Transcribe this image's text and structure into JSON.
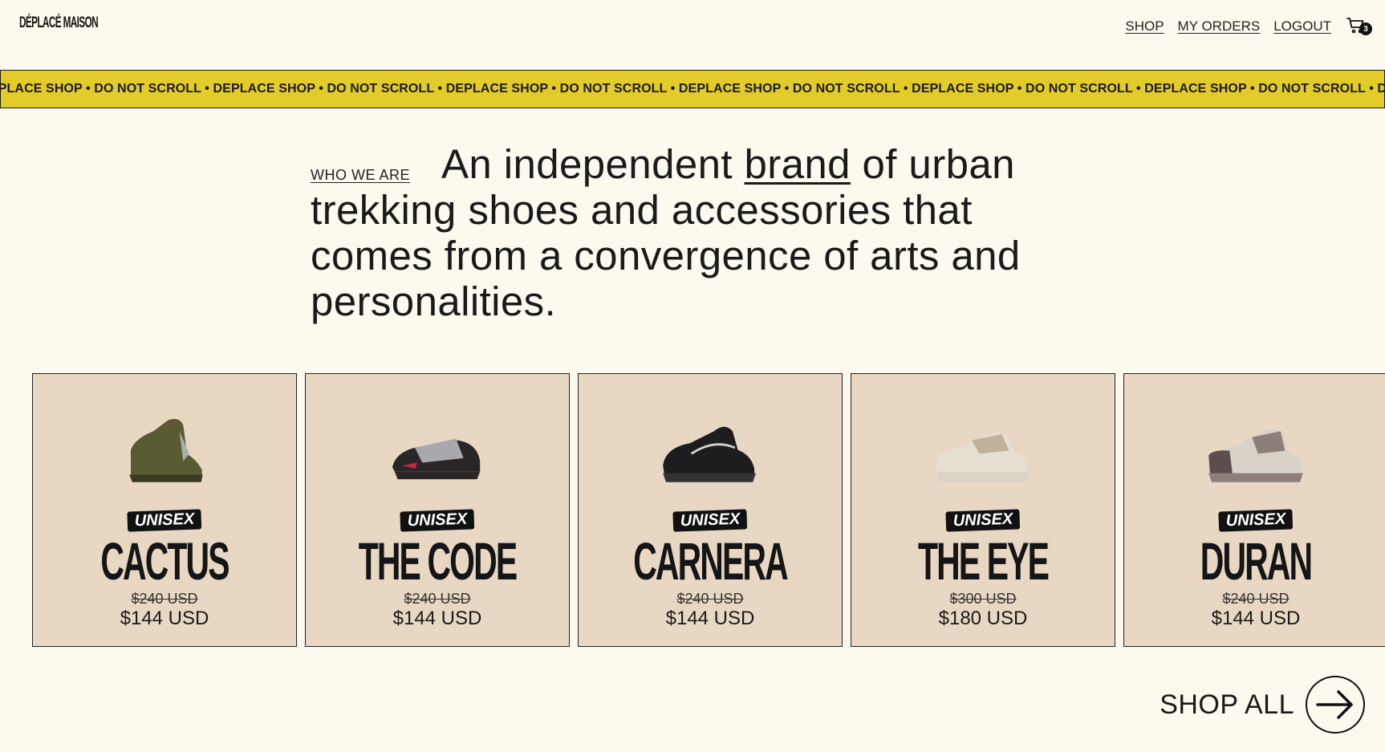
{
  "header": {
    "logo": "DÉPLACÉ MAISON",
    "nav": [
      "SHOP",
      "MY ORDERS",
      "LOGOUT"
    ],
    "cart_count": "3"
  },
  "marquee": {
    "text": "EPLACE SHOP • DO NOT SCROLL • DEPLACE SHOP • DO NOT SCROLL • DEPLACE SHOP • DO NOT SCROLL • DEPLACE SHOP • DO NOT SCROLL • DEPLACE SHOP • DO NOT SCROLL • DEPLACE SHOP • DO NOT SCROLL • DEPLACE"
  },
  "intro": {
    "label": "WHO WE ARE",
    "text_before": "An independent ",
    "text_link": "brand",
    "text_after": " of urban trekking shoes and accessories that comes from a convergence of arts and personalities."
  },
  "products": [
    {
      "tag": "UNISEX",
      "name": "CACTUS",
      "old_price": "$240 USD",
      "price": "$144 USD",
      "colors": [
        "#5b5b33",
        "#3d3a22",
        "#a9b0b4"
      ]
    },
    {
      "tag": "UNISEX",
      "name": "THE CODE",
      "old_price": "$240 USD",
      "price": "$144 USD",
      "colors": [
        "#2a2628",
        "#a8a8ad",
        "#c4283a"
      ]
    },
    {
      "tag": "UNISEX",
      "name": "CARNERA",
      "old_price": "$240 USD",
      "price": "$144 USD",
      "colors": [
        "#1d1d1f",
        "#333336",
        "#d8d0d0"
      ]
    },
    {
      "tag": "UNISEX",
      "name": "THE EYE",
      "old_price": "$300 USD",
      "price": "$180 USD",
      "colors": [
        "#e6e0d2",
        "#bfb19a",
        "#d9d4c6"
      ]
    },
    {
      "tag": "UNISEX",
      "name": "DURAN",
      "old_price": "$240 USD",
      "price": "$144 USD",
      "colors": [
        "#8c7f7a",
        "#5c4e4d",
        "#d8d2c8"
      ]
    }
  ],
  "shop_all": "SHOP ALL"
}
